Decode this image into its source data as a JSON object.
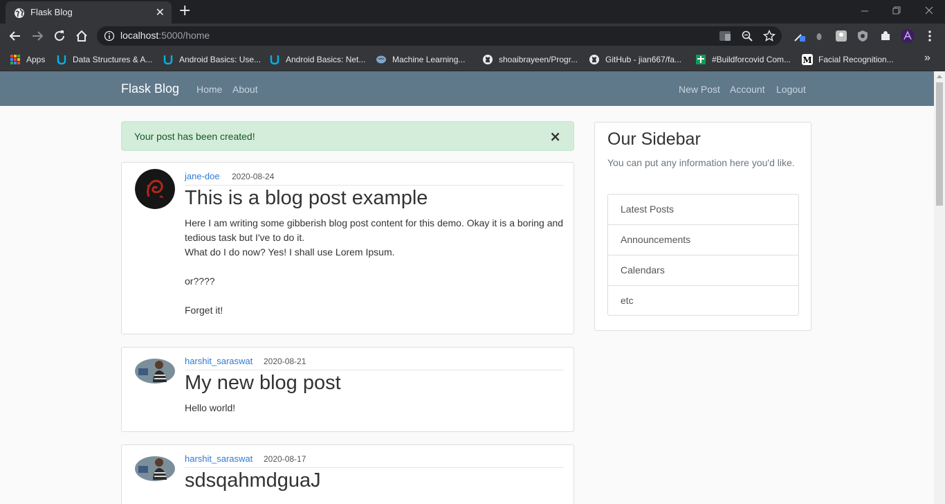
{
  "browser": {
    "tab_title": "Flask Blog",
    "tab_close": "✕",
    "new_tab": "+",
    "url_host": "localhost",
    "url_path": ":5000/home",
    "bookmarks": [
      {
        "label": "Apps",
        "icon": "apps-grid-icon",
        "color": "#e8453c"
      },
      {
        "label": "Data Structures & A...",
        "icon": "udacity-icon",
        "color": "#02b3e4"
      },
      {
        "label": "Android Basics: Use...",
        "icon": "udacity-icon",
        "color": "#02b3e4"
      },
      {
        "label": "Android Basics: Net...",
        "icon": "udacity-icon",
        "color": "#02b3e4"
      },
      {
        "label": "Machine Learning...",
        "icon": "brain-icon",
        "color": "#7fa7c9"
      },
      {
        "label": "shoaibrayeen/Progr...",
        "icon": "github-icon",
        "color": "#e8eaed"
      },
      {
        "label": "GitHub - jian667/fa...",
        "icon": "github-icon",
        "color": "#e8eaed"
      },
      {
        "label": "#Buildforcovid Com...",
        "icon": "devpost-icon",
        "color": "#0f9d58"
      },
      {
        "label": "Facial Recognition...",
        "icon": "medium-icon",
        "color": "#ffffff"
      }
    ],
    "more_bookmarks": "»"
  },
  "navbar": {
    "brand": "Flask Blog",
    "left_links": [
      "Home",
      "About"
    ],
    "right_links": [
      "New Post",
      "Account",
      "Logout"
    ]
  },
  "alert": {
    "message": "Your post has been created!",
    "close": "×"
  },
  "posts": [
    {
      "author": "jane-doe",
      "date": "2020-08-24",
      "title": "This is a blog post example",
      "body": [
        "Here I am writing some gibberish blog post content for this demo. Okay it is a boring and tedious task but I've to do it.",
        "What do I do now? Yes! I shall use Lorem Ipsum.",
        "",
        "or????",
        "",
        "Forget it!"
      ],
      "avatar": "dragon-sigil-avatar"
    },
    {
      "author": "harshit_saraswat",
      "date": "2020-08-21",
      "title": "My new blog post",
      "body": [
        "Hello world!"
      ],
      "avatar": "user-photo-avatar"
    },
    {
      "author": "harshit_saraswat",
      "date": "2020-08-17",
      "title": "sdsqahmdguaJ",
      "body": [],
      "avatar": "user-photo-avatar"
    }
  ],
  "sidebar": {
    "title": "Our Sidebar",
    "description": "You can put any information here you'd like.",
    "items": [
      "Latest Posts",
      "Announcements",
      "Calendars",
      "etc"
    ]
  },
  "colors": {
    "navbar": "#5f788a",
    "alert_bg": "#d4edda",
    "alert_text": "#155724",
    "link": "#2c7bd5"
  }
}
